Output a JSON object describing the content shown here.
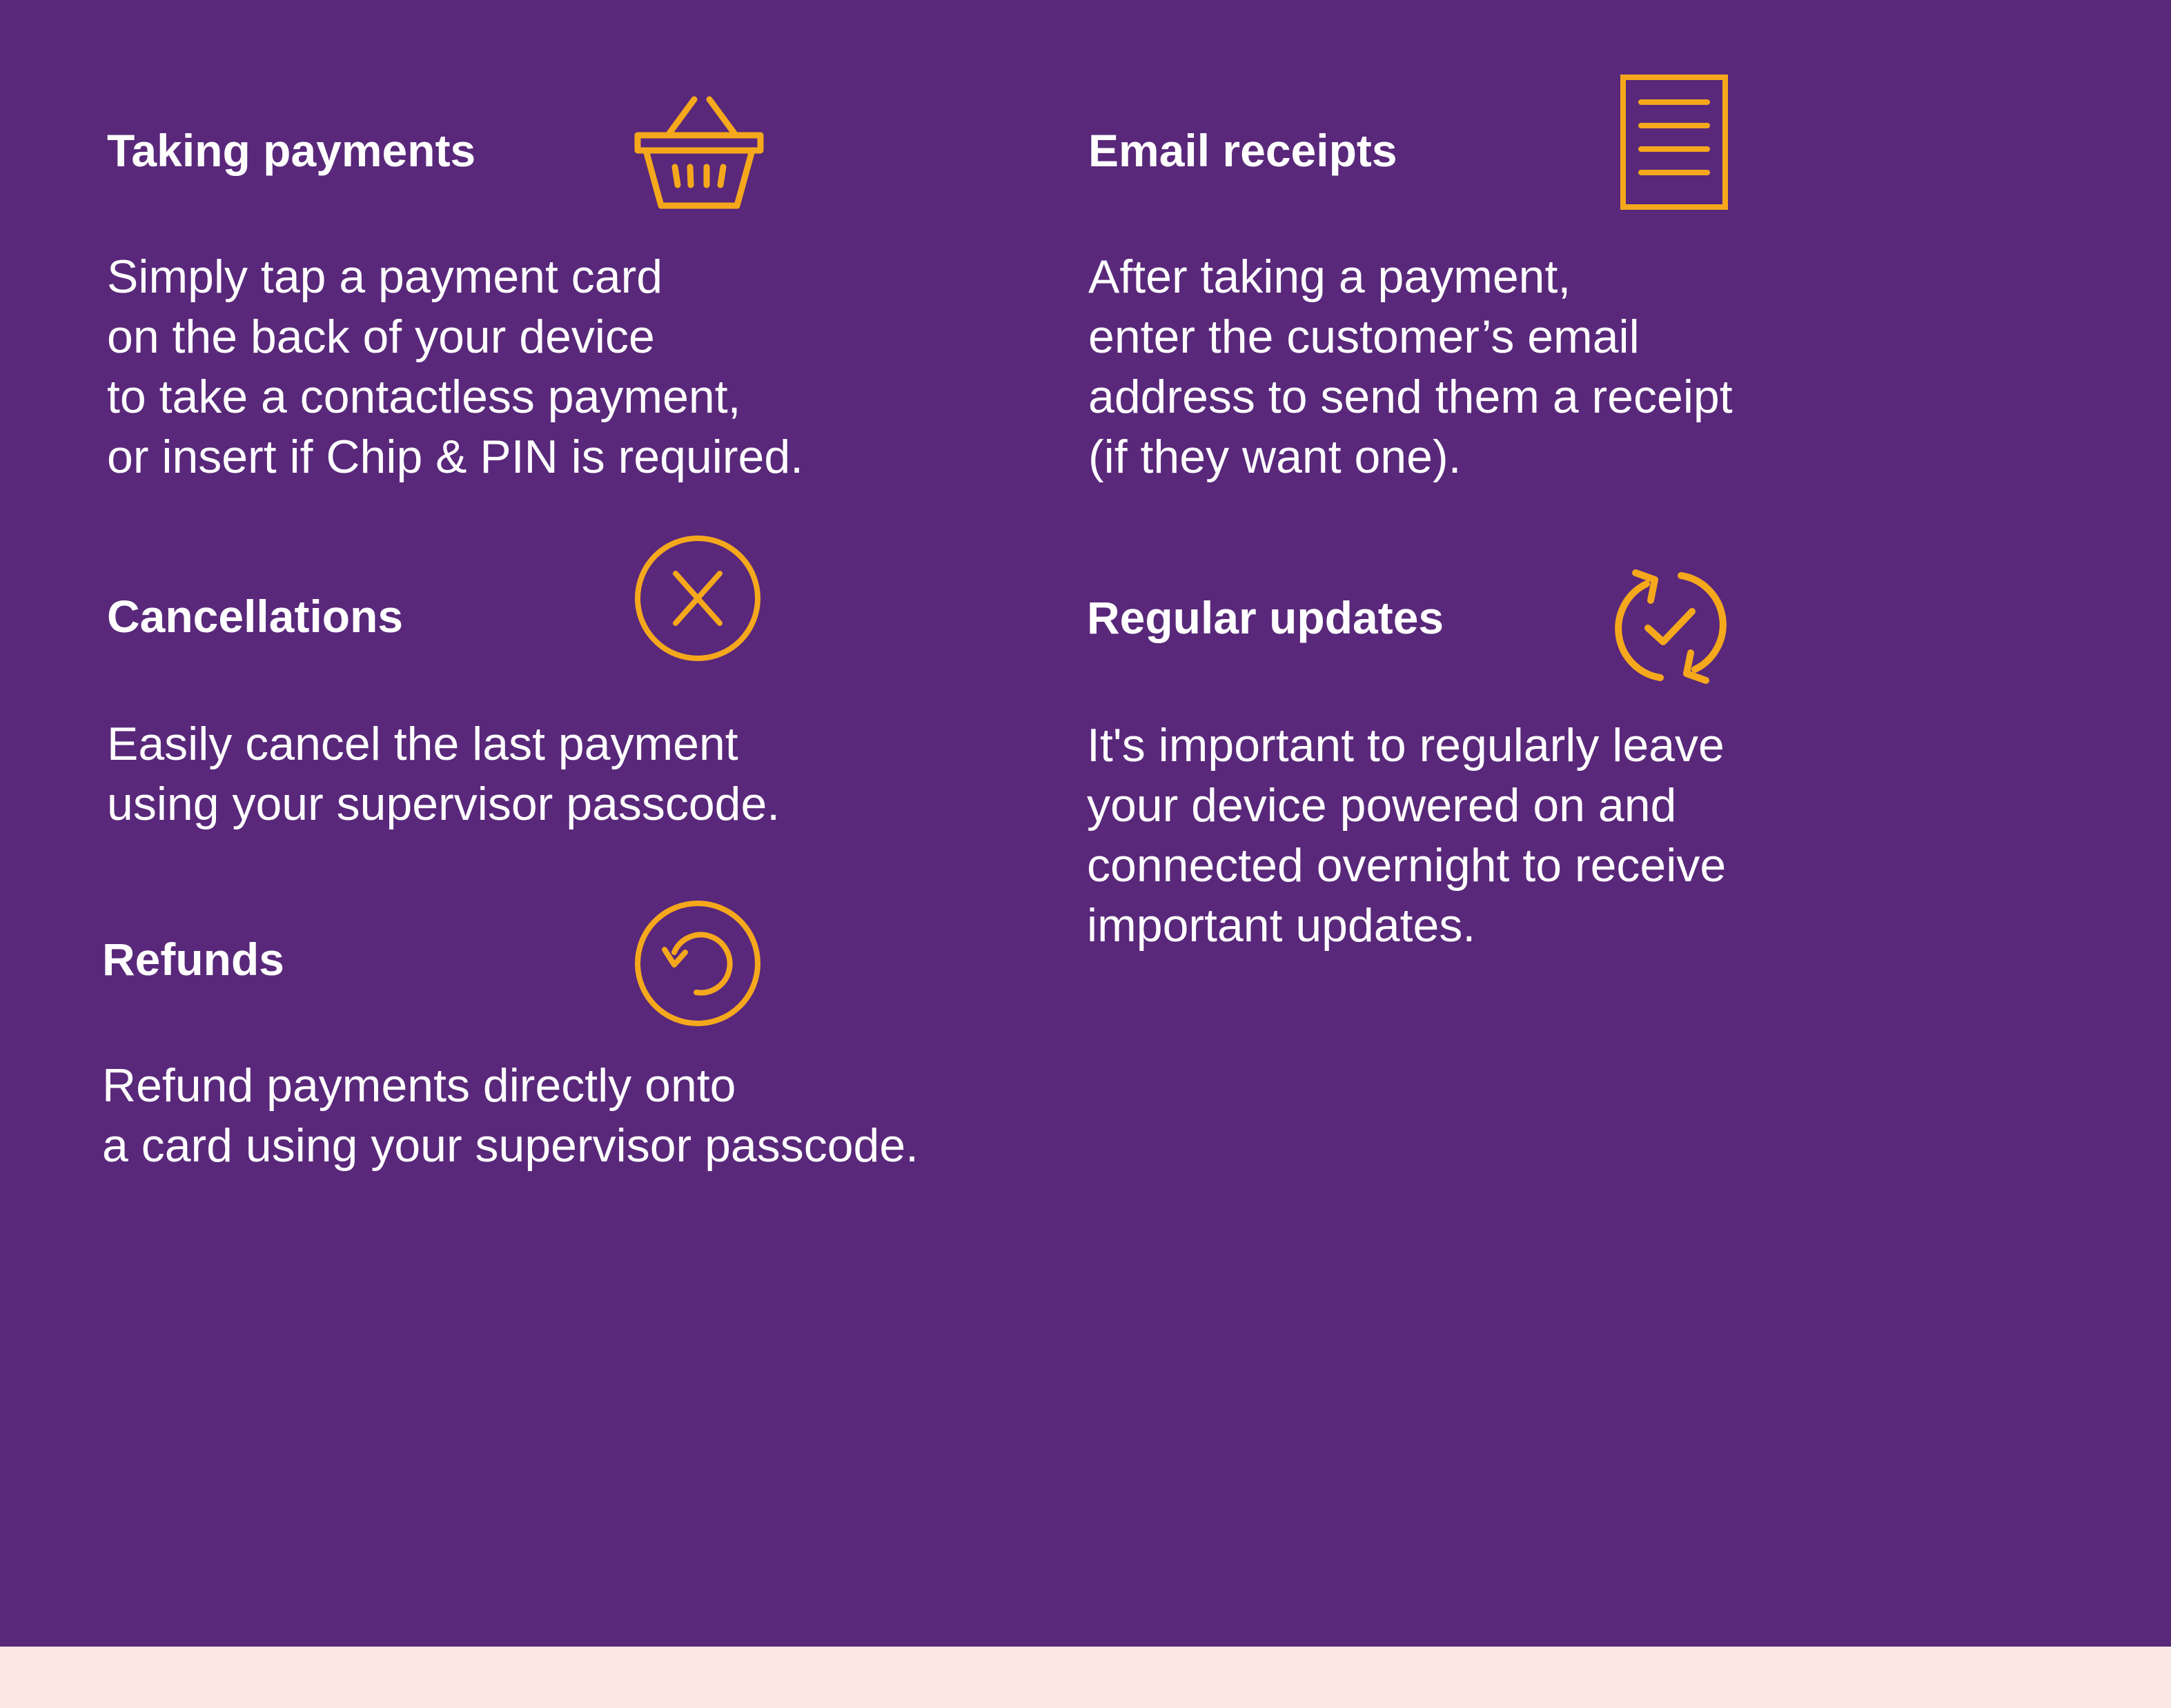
{
  "theme": {
    "panel_color": "#59287A",
    "accent_color": "#F5A81C",
    "text_color": "#FFFFFF",
    "strip_color": "#FCE8E2"
  },
  "features": {
    "taking_payments": {
      "title": "Taking payments",
      "icon": "basket-icon",
      "lines": [
        "Simply tap a payment card",
        "on the back of your device",
        "to take a contactless payment,",
        "or insert if Chip & PIN is required."
      ]
    },
    "cancellations": {
      "title": "Cancellations",
      "icon": "cancel-circle-icon",
      "lines": [
        "Easily cancel the last payment",
        "using your supervisor passcode."
      ]
    },
    "refunds": {
      "title": "Refunds",
      "icon": "refund-circle-icon",
      "lines": [
        "Refund payments directly onto",
        "a card using your supervisor passcode."
      ]
    },
    "email_receipts": {
      "title": "Email receipts",
      "icon": "receipt-icon",
      "lines": [
        "After taking a payment,",
        "enter the customer’s email",
        "address to send them a receipt",
        "(if they want one)."
      ]
    },
    "regular_updates": {
      "title": "Regular updates",
      "icon": "sync-check-icon",
      "lines": [
        "It's important to regularly leave",
        "your device powered on and",
        "connected overnight to receive",
        "important updates."
      ]
    }
  }
}
